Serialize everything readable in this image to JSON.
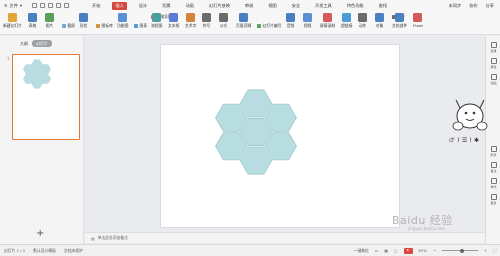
{
  "menu": {
    "file": "文件",
    "tabs": [
      "开始",
      "插入",
      "设计",
      "切换",
      "动画",
      "幻灯片放映",
      "审阅",
      "视图",
      "安全",
      "开发工具",
      "特色功能",
      "查找"
    ],
    "active_tab": "插入",
    "right": [
      "未同步",
      "协作",
      "分享"
    ]
  },
  "ribbon": {
    "groups": [
      {
        "label": "新建幻灯片",
        "color": "#e2a53a"
      },
      {
        "label": "表格",
        "color": "#4a7fc1"
      },
      {
        "label": "图片",
        "color": "#5aa05a"
      },
      {
        "label": "截屏",
        "color": "#7aa0d6"
      },
      {
        "label": "形状",
        "color": "#4a7fc1"
      },
      {
        "label": "图标库",
        "color": "#d4943a"
      },
      {
        "label": "功能图",
        "color": "#5b8fd6"
      },
      {
        "label": "图表",
        "color": "#4a9bd6"
      },
      {
        "label": "思维导图",
        "color": "#d45a5a"
      },
      {
        "label": "流程图",
        "color": "#4aa0a0"
      },
      {
        "label": "文本框",
        "color": "#5b7bd6"
      },
      {
        "label": "艺术字",
        "color": "#d4843a"
      },
      {
        "label": "符号",
        "color": "#6b6b6b"
      },
      {
        "label": "公式",
        "color": "#6b6b6b"
      },
      {
        "label": "页眉页脚",
        "color": "#4a7fc1"
      },
      {
        "label": "幻灯片编号",
        "color": "#5aa05a"
      },
      {
        "label": "音频",
        "color": "#4a7fc1"
      },
      {
        "label": "视频",
        "color": "#5b8fd6"
      },
      {
        "label": "屏幕录制",
        "color": "#d45a5a"
      },
      {
        "label": "超链接",
        "color": "#4a9bd6"
      },
      {
        "label": "动作",
        "color": "#6b6b6b"
      },
      {
        "label": "对象",
        "color": "#4a7fc1"
      },
      {
        "label": "附件",
        "color": "#6b6b6b"
      },
      {
        "label": "文档部件",
        "color": "#4a7fc1"
      },
      {
        "label": "Flash",
        "color": "#d45a5a"
      }
    ]
  },
  "left_pane": {
    "tabs": [
      "大纲",
      "幻灯片"
    ],
    "active_tab": "幻灯片",
    "slide_number": "1",
    "add_button": "+"
  },
  "notes": {
    "placeholder": "单击此处添加备注"
  },
  "right_panel": {
    "items": [
      "选择",
      "属性",
      "动画",
      "形状",
      "备注",
      "样式",
      "更多"
    ]
  },
  "status": {
    "slide": "幻灯片 1 / 1",
    "theme": "默认设计模板",
    "protect": "文档未保护",
    "beautify": "一键美化",
    "zoom": "97%"
  },
  "watermark": {
    "text": "Baidu 经验",
    "sub": "jingyan.baidu.com"
  },
  "shape": {
    "name": "hexagon",
    "fill": "#b7dde0",
    "stroke": "#9fc9cc"
  }
}
